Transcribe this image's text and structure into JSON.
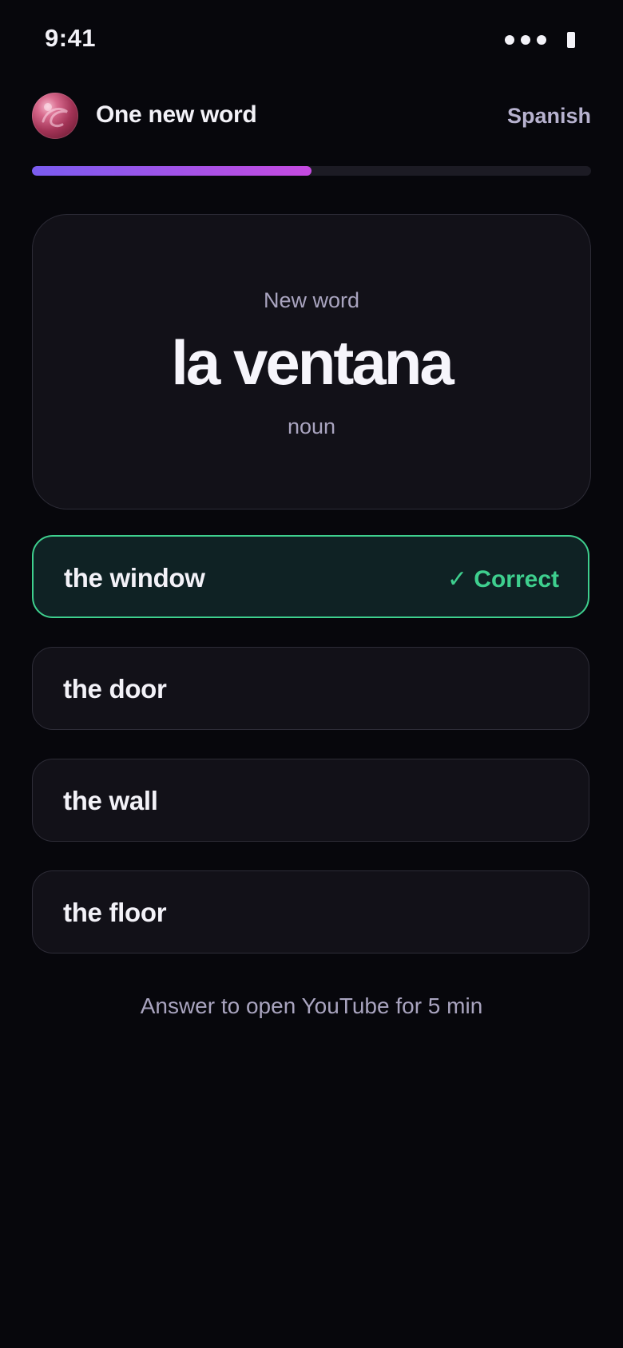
{
  "status_bar": {
    "time": "9:41",
    "icons": [
      "signal-dots-icon",
      "battery-icon"
    ]
  },
  "header": {
    "avatar_icon": "avatar-orb",
    "title": "One new word",
    "language": "Spanish"
  },
  "progress": {
    "fraction": 0.5,
    "colors": [
      "#7a5cf0",
      "#c54ae0"
    ]
  },
  "card": {
    "label": "New word",
    "word": "la ventana",
    "part_of_speech": "noun"
  },
  "options": [
    {
      "label": "the window",
      "state": "correct",
      "badge": "✓ Correct"
    },
    {
      "label": "the door",
      "state": "default"
    },
    {
      "label": "the wall",
      "state": "default"
    },
    {
      "label": "the floor",
      "state": "default"
    }
  ],
  "footer": {
    "hint": "Answer to open YouTube for 5 min"
  },
  "colors": {
    "background": "#07070c",
    "correct": "#3ecf8e",
    "muted_text": "#a9a4bf"
  }
}
